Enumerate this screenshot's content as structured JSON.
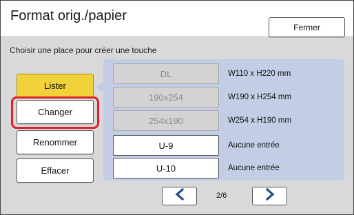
{
  "header": {
    "title": "Format orig./papier",
    "close_label": "Fermer"
  },
  "instruction": "Choisir une place pour créer une touche",
  "actions": {
    "lister": "Lister",
    "changer": "Changer",
    "renommer": "Renommer",
    "effacer": "Effacer"
  },
  "entries": [
    {
      "key": "DL",
      "desc": "W110 x H220 mm",
      "enabled": false
    },
    {
      "key": "190x254",
      "desc": "W190 x H254 mm",
      "enabled": false
    },
    {
      "key": "254x190",
      "desc": "W254 x H190 mm",
      "enabled": false
    },
    {
      "key": "U-9",
      "desc": "Aucune entrée",
      "enabled": true
    },
    {
      "key": "U-10",
      "desc": "Aucune entrée",
      "enabled": true
    }
  ],
  "pagination": {
    "page": "2/6",
    "prev_icon": "chevron-left-icon",
    "next_icon": "chevron-right-icon"
  },
  "colors": {
    "accent": "#f1d23a",
    "highlight": "#e0202c",
    "panel": "#c3cde5",
    "arrow": "#1f4e8c"
  }
}
